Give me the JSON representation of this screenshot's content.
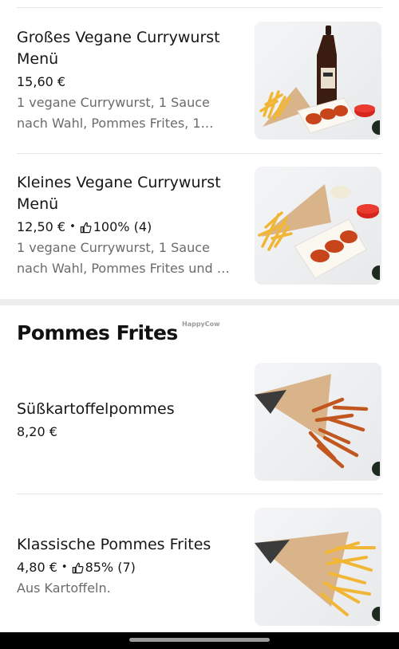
{
  "items_top": [
    {
      "name": "Großes Vegane Currywurst Menü",
      "price": "15,60 €",
      "description_line1": "1 vegane Currywurst, 1 Sauce",
      "description_line2": "nach Wahl, Pommes Frites, 1…",
      "photo": "currywurst-menu-with-drink-photo"
    },
    {
      "name": "Kleines Vegane Currywurst Menü",
      "price": "12,50 €",
      "rating": "100% (4)",
      "rating_fraction": 1.0,
      "description_line1": "1 vegane Currywurst, 1 Sauce",
      "description_line2": "nach Wahl, Pommes Frites und …",
      "photo": "currywurst-menu-photo"
    }
  ],
  "section": {
    "title": "Pommes Frites",
    "watermark": "HappyCow"
  },
  "items_bottom": [
    {
      "name": "Süßkartoffelpommes",
      "price": "8,20 €",
      "photo": "sweet-potato-fries-photo"
    },
    {
      "name": "Klassische Pommes Frites",
      "price": "4,80 €",
      "rating": "85% (7)",
      "rating_fraction": 0.85,
      "description": "Aus Kartoffeln.",
      "photo": "classic-fries-photo"
    }
  ],
  "separator": "•",
  "colors": {
    "text": "#161616",
    "muted": "#6b6b6b",
    "fries": "#f2b636",
    "sweet_fries": "#c2561f",
    "paper": "#d9b48a",
    "ketchup": "#d7261e"
  },
  "icons": [
    "thumbs-up-icon",
    "vegan-badge-icon"
  ]
}
